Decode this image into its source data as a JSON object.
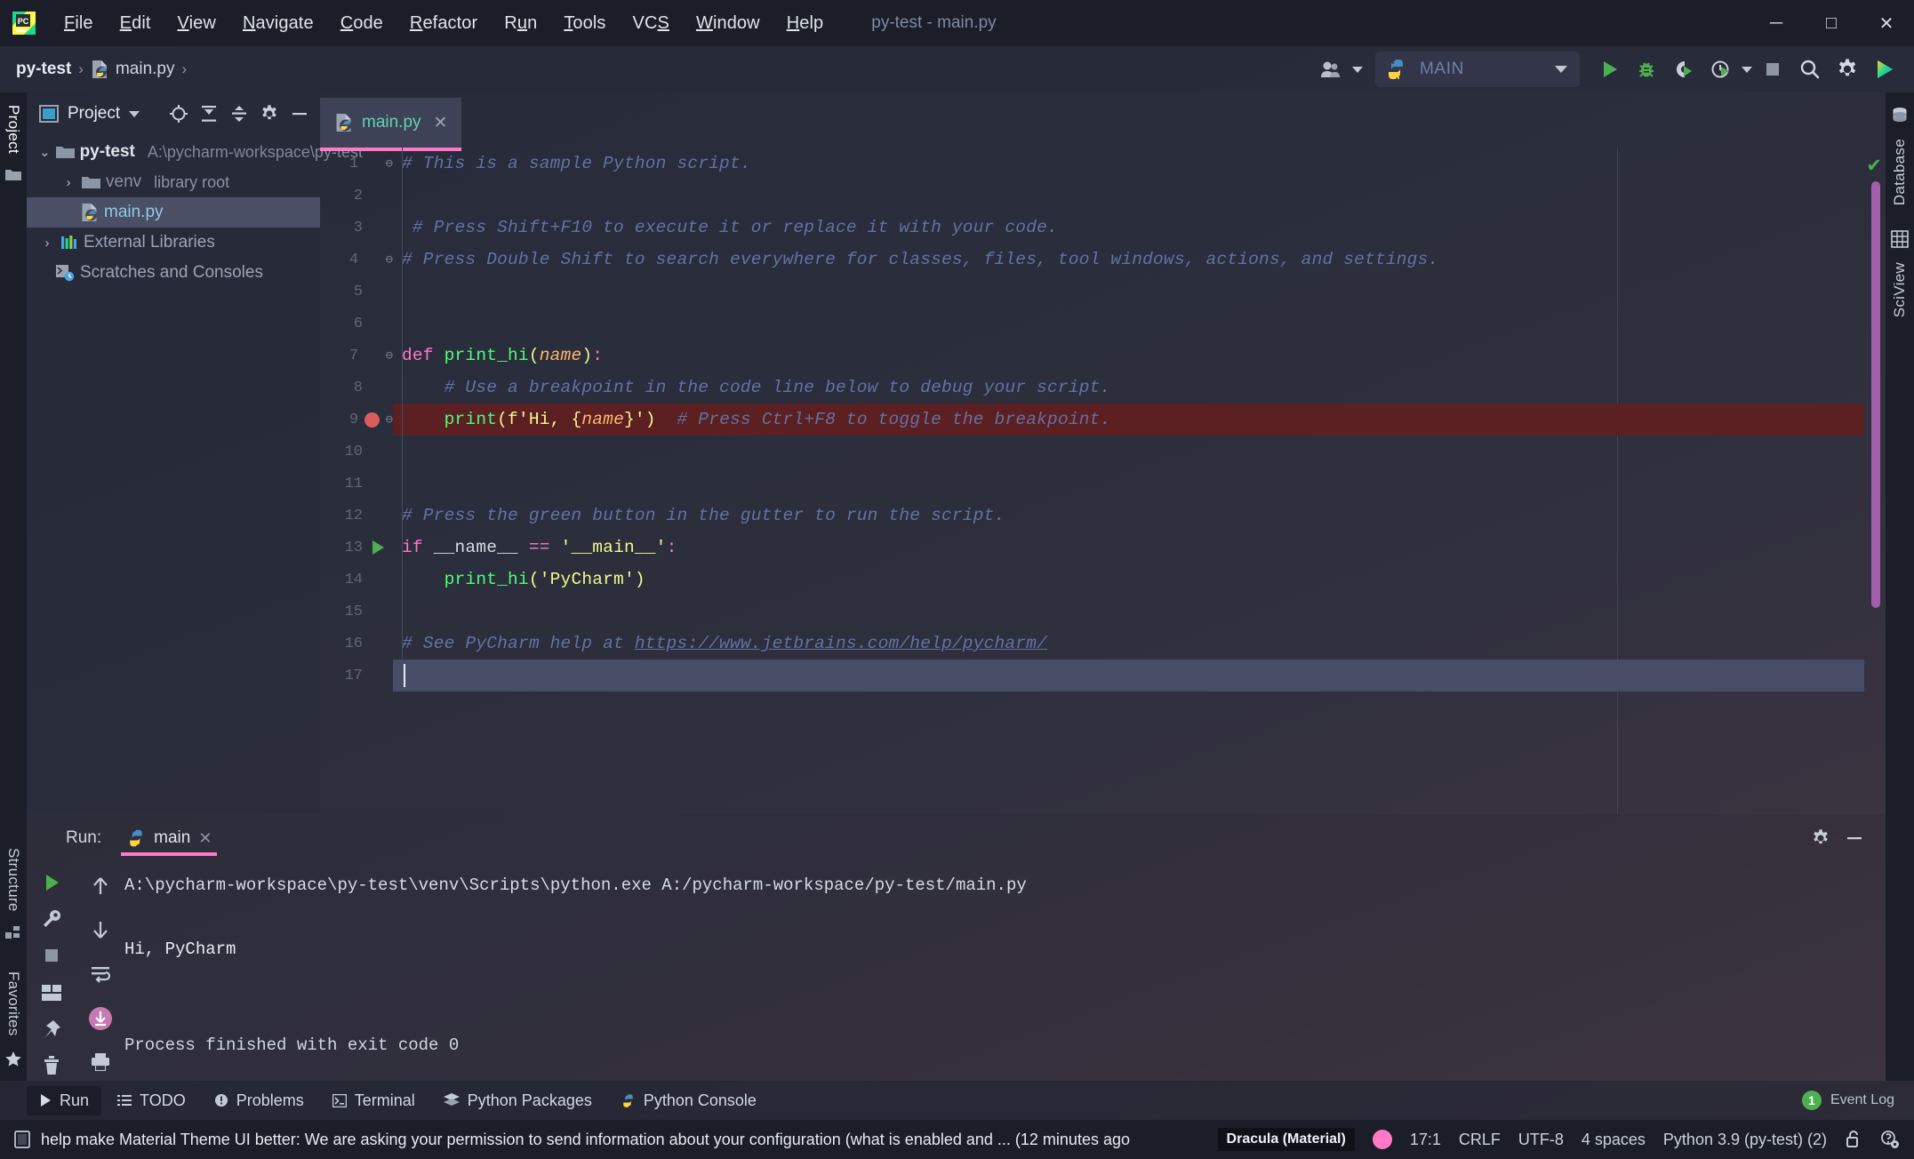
{
  "window": {
    "title": "py-test - main.py",
    "controls": {
      "minimize": "─",
      "maximize": "□",
      "close": "✕"
    }
  },
  "menu": {
    "items": [
      {
        "label": "File"
      },
      {
        "label": "Edit"
      },
      {
        "label": "View"
      },
      {
        "label": "Navigate"
      },
      {
        "label": "Code"
      },
      {
        "label": "Refactor"
      },
      {
        "label": "Run"
      },
      {
        "label": "Tools"
      },
      {
        "label": "VCS"
      },
      {
        "label": "Window"
      },
      {
        "label": "Help"
      }
    ]
  },
  "breadcrumb": {
    "project": "py-test",
    "separator": "›",
    "file": "main.py",
    "trailing": "›"
  },
  "toolbar": {
    "run_config": {
      "label": "MAIN",
      "icon": "python-icon",
      "dropdown": "▾"
    },
    "buttons": [
      {
        "name": "run-button",
        "title": "Run"
      },
      {
        "name": "debug-button",
        "title": "Debug"
      },
      {
        "name": "run-coverage-button",
        "title": "Run with Coverage"
      },
      {
        "name": "profile-button",
        "title": "Profile"
      },
      {
        "name": "stop-button",
        "title": "Stop"
      },
      {
        "name": "search-everywhere-button",
        "title": "Search Everywhere"
      },
      {
        "name": "settings-button",
        "title": "Settings"
      },
      {
        "name": "updates-button",
        "title": "Updates"
      }
    ]
  },
  "left_rail": {
    "top_tab": "Project",
    "bottom_tabs": [
      "Structure",
      "Favorites"
    ]
  },
  "right_rail": {
    "tabs": [
      "Database",
      "SciView"
    ]
  },
  "project_panel": {
    "title": "Project",
    "dropdown": "▾",
    "actions": [
      "locate-icon",
      "expand-all-icon",
      "collapse-all-icon",
      "gear-icon",
      "hide-icon"
    ],
    "tree": [
      {
        "indent": 0,
        "arrow": "⌄",
        "icon": "folder-icon",
        "label": "py-test",
        "bold": true,
        "path": "A:\\pycharm-workspace\\py-test",
        "selected": false
      },
      {
        "indent": 1,
        "arrow": "›",
        "icon": "folder-icon",
        "label": "venv",
        "bold": false,
        "sub": "library root",
        "selected": false,
        "dim": true
      },
      {
        "indent": 2,
        "arrow": "",
        "icon": "python-file-icon",
        "label": "main.py",
        "bold": false,
        "selected": true,
        "py": true
      },
      {
        "indent": 0,
        "arrow": "›",
        "icon": "libraries-icon",
        "label": "External Libraries",
        "bold": false,
        "selected": false
      },
      {
        "indent": 0,
        "arrow": "",
        "icon": "scratches-icon",
        "label": "Scratches and Consoles",
        "bold": false,
        "selected": false
      }
    ]
  },
  "editor": {
    "tabs": [
      {
        "label": "main.py",
        "icon": "python-file-icon",
        "close": "✕",
        "active": true
      }
    ],
    "lines": [
      {
        "num": "1",
        "fold": "⊖",
        "tokens": [
          {
            "t": "# This is a sample Python script.",
            "c": "c-com"
          }
        ]
      },
      {
        "num": "2",
        "tokens": []
      },
      {
        "num": "3",
        "tokens": [
          {
            "t": " # Press Shift+F10 to execute it or replace it with your code.",
            "c": "c-com"
          }
        ]
      },
      {
        "num": "4",
        "fold": "⊖",
        "tokens": [
          {
            "t": "# Press Double Shift to search everywhere for classes, files, tool windows, actions, and settings.",
            "c": "c-com"
          }
        ]
      },
      {
        "num": "5",
        "tokens": []
      },
      {
        "num": "6",
        "tokens": []
      },
      {
        "num": "7",
        "fold": "⊖",
        "tokens": [
          {
            "t": "def ",
            "c": "c-kw"
          },
          {
            "t": "print_hi",
            "c": "c-fn"
          },
          {
            "t": "(",
            "c": "c-par"
          },
          {
            "t": "name",
            "c": "c-var"
          },
          {
            "t": ")",
            "c": "c-par"
          },
          {
            "t": ":",
            "c": "c-op"
          }
        ]
      },
      {
        "num": "8",
        "tokens": [
          {
            "t": "    # Use a breakpoint in the code line below to debug your script.",
            "c": "c-com"
          }
        ]
      },
      {
        "num": "9",
        "breakpoint": true,
        "highlight": "breakpoint",
        "fold": "⊖",
        "tokens": [
          {
            "t": "    ",
            "c": "c-plain"
          },
          {
            "t": "print",
            "c": "c-fn"
          },
          {
            "t": "(",
            "c": "c-par"
          },
          {
            "t": "f'Hi, ",
            "c": "c-str"
          },
          {
            "t": "{",
            "c": "c-par"
          },
          {
            "t": "name",
            "c": "c-var"
          },
          {
            "t": "}",
            "c": "c-par"
          },
          {
            "t": "'",
            "c": "c-str"
          },
          {
            "t": ")",
            "c": "c-par"
          },
          {
            "t": "  # Press Ctrl+F8 to toggle the breakpoint.",
            "c": "c-com"
          }
        ]
      },
      {
        "num": "10",
        "tokens": []
      },
      {
        "num": "11",
        "tokens": []
      },
      {
        "num": "12",
        "tokens": [
          {
            "t": "# Press the green button in the gutter to run the script.",
            "c": "c-com"
          }
        ]
      },
      {
        "num": "13",
        "runmark": true,
        "tokens": [
          {
            "t": "if ",
            "c": "c-kw"
          },
          {
            "t": "__name__ ",
            "c": "c-plain"
          },
          {
            "t": "== ",
            "c": "c-op"
          },
          {
            "t": "'__main__'",
            "c": "c-str"
          },
          {
            "t": ":",
            "c": "c-op"
          }
        ]
      },
      {
        "num": "14",
        "tokens": [
          {
            "t": "    ",
            "c": "c-plain"
          },
          {
            "t": "print_hi",
            "c": "c-fn"
          },
          {
            "t": "(",
            "c": "c-par"
          },
          {
            "t": "'PyCharm'",
            "c": "c-str"
          },
          {
            "t": ")",
            "c": "c-par"
          }
        ]
      },
      {
        "num": "15",
        "tokens": []
      },
      {
        "num": "16",
        "tokens": [
          {
            "t": "# See PyCharm help at ",
            "c": "c-com"
          },
          {
            "t": "https://www.jetbrains.com/help/pycharm/",
            "c": "c-link"
          }
        ]
      },
      {
        "num": "17",
        "highlight": "caret",
        "caret": true,
        "tokens": []
      }
    ],
    "inspection_status": "✔"
  },
  "run_panel": {
    "label": "Run:",
    "tab": {
      "name": "main",
      "icon": "python-icon",
      "close": "✕"
    },
    "header_actions": [
      "gear-icon",
      "hide-icon"
    ],
    "side_buttons": [
      "rerun-icon",
      "wrench-icon",
      "stop-icon",
      "layout-icon",
      "pin-icon",
      "trash-icon",
      "scroll-up-icon",
      "scroll-down-icon",
      "soft-wrap-icon",
      "scroll-end-icon",
      "print-icon"
    ],
    "console": [
      {
        "text": "A:\\pycharm-workspace\\py-test\\venv\\Scripts\\python.exe A:/pycharm-workspace/py-test/main.py",
        "cls": "cl-cmd"
      },
      {
        "text": "",
        "cls": "cl-out"
      },
      {
        "text": "Hi, PyCharm",
        "cls": "cl-out"
      },
      {
        "text": "",
        "cls": "cl-out"
      },
      {
        "text": "",
        "cls": "cl-out"
      },
      {
        "text": "Process finished with exit code 0",
        "cls": "cl-fin"
      }
    ]
  },
  "tool_windows": {
    "items": [
      {
        "label": "Run",
        "icon": "play-icon",
        "active": true
      },
      {
        "label": "TODO",
        "icon": "list-icon",
        "active": false
      },
      {
        "label": "Problems",
        "icon": "warning-icon",
        "active": false
      },
      {
        "label": "Terminal",
        "icon": "terminal-icon",
        "active": false
      },
      {
        "label": "Python Packages",
        "icon": "packages-icon",
        "active": false
      },
      {
        "label": "Python Console",
        "icon": "python-icon",
        "active": false
      }
    ],
    "event_log": {
      "count": "1",
      "label": "Event Log"
    }
  },
  "status_bar": {
    "message": "help make Material Theme UI better: We are asking your permission to send information about your configuration (what is enabled and ... (12 minutes ago",
    "theme": "Dracula (Material)",
    "position": "17:1",
    "line_ending": "CRLF",
    "encoding": "UTF-8",
    "indent": "4 spaces",
    "interpreter": "Python 3.9 (py-test) (2)"
  },
  "colors": {
    "accent_pink": "#ff79c6",
    "titlebar_bg": "#1b1d29",
    "selection": "#4a4f66",
    "breakpoint_line": "#5c1f22",
    "green": "#4caf50"
  }
}
